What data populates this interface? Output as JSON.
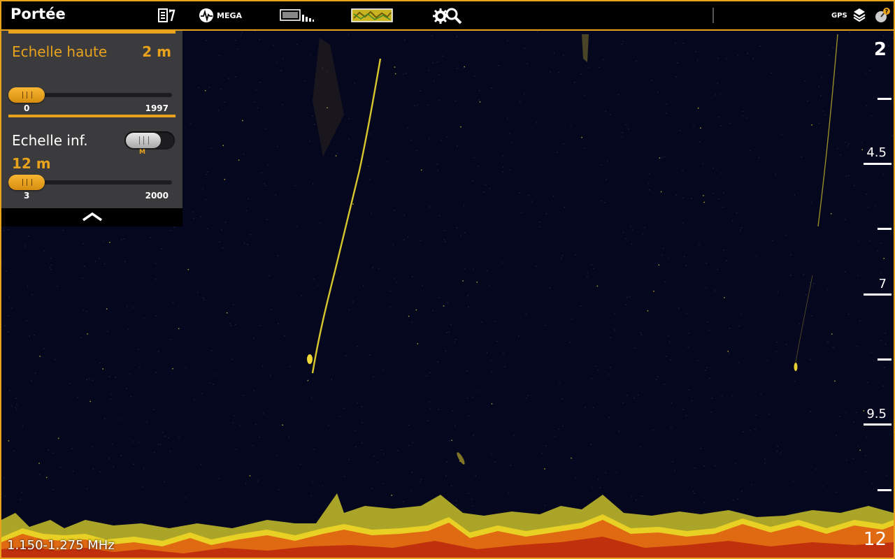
{
  "app": {
    "title": "Portée"
  },
  "toolbar": {
    "mega_label": "MEGA",
    "gps_label": "GPS",
    "accent_color": "#e8a21c"
  },
  "range_panel": {
    "upper": {
      "label": "Echelle haute",
      "value": "2 m",
      "min_label": "0",
      "max_label": "1997"
    },
    "lower": {
      "label": "Echelle inf.",
      "value": "12 m",
      "toggle_label": "M",
      "min_label": "3",
      "max_label": "2000"
    }
  },
  "depth_scale": {
    "labels": [
      "2",
      "4.5",
      "7",
      "9.5",
      "12"
    ]
  },
  "frequency": "1.150-1.275 MHz"
}
